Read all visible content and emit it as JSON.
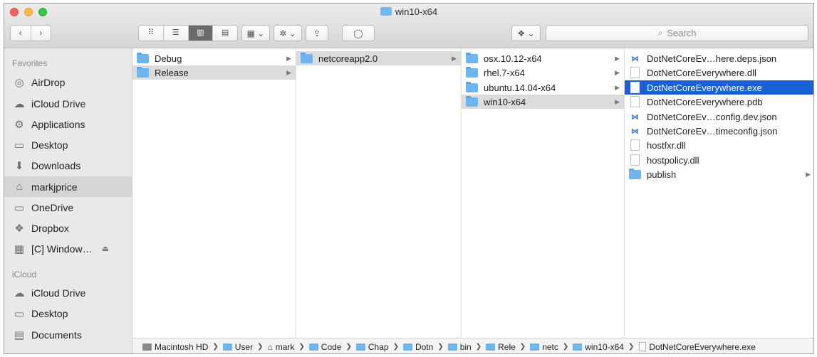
{
  "window": {
    "title": "win10-x64"
  },
  "toolbar": {
    "back": "‹",
    "forward": "›",
    "view_icon": "⠿",
    "view_list": "☰",
    "view_column": "▥",
    "view_gallery": "▤",
    "group": "▦ ⌄",
    "action": "✲ ⌄",
    "share": "⇪",
    "tag": "◯",
    "dropbox": "❖ ⌄",
    "search_icon": "⌕",
    "search_placeholder": "Search"
  },
  "sidebar": {
    "favorites_header": "Favorites",
    "icloud_header": "iCloud",
    "favorites": [
      {
        "label": "AirDrop",
        "icon": "◎"
      },
      {
        "label": "iCloud Drive",
        "icon": "☁"
      },
      {
        "label": "Applications",
        "icon": "⚙"
      },
      {
        "label": "Desktop",
        "icon": "▭"
      },
      {
        "label": "Downloads",
        "icon": "⬇"
      },
      {
        "label": "markjprice",
        "icon": "⌂"
      },
      {
        "label": "OneDrive",
        "icon": "▭"
      },
      {
        "label": "Dropbox",
        "icon": "❖"
      },
      {
        "label": "[C] Window…",
        "icon": "▦",
        "eject": "⏏"
      }
    ],
    "icloud": [
      {
        "label": "iCloud Drive",
        "icon": "☁"
      },
      {
        "label": "Desktop",
        "icon": "▭"
      },
      {
        "label": "Documents",
        "icon": "▤"
      }
    ]
  },
  "columns": {
    "col1": [
      "Debug",
      "Release"
    ],
    "col2": [
      "netcoreapp2.0"
    ],
    "col3": [
      "osx.10.12-x64",
      "rhel.7-x64",
      "ubuntu.14.04-x64",
      "win10-x64"
    ],
    "col4": [
      "DotNetCoreEv…here.deps.json",
      "DotNetCoreEverywhere.dll",
      "DotNetCoreEverywhere.exe",
      "DotNetCoreEverywhere.pdb",
      "DotNetCoreEv…config.dev.json",
      "DotNetCoreEv…timeconfig.json",
      "hostfxr.dll",
      "hostpolicy.dll",
      "publish"
    ]
  },
  "pathbar": [
    "Macintosh HD",
    "User",
    "mark",
    "Code",
    "Chap",
    "Dotn",
    "bin",
    "Rele",
    "netc",
    "win10-x64",
    "DotNetCoreEverywhere.exe"
  ],
  "colors": {
    "selection": "#1a5fd6",
    "folder": "#6fb5ee"
  }
}
